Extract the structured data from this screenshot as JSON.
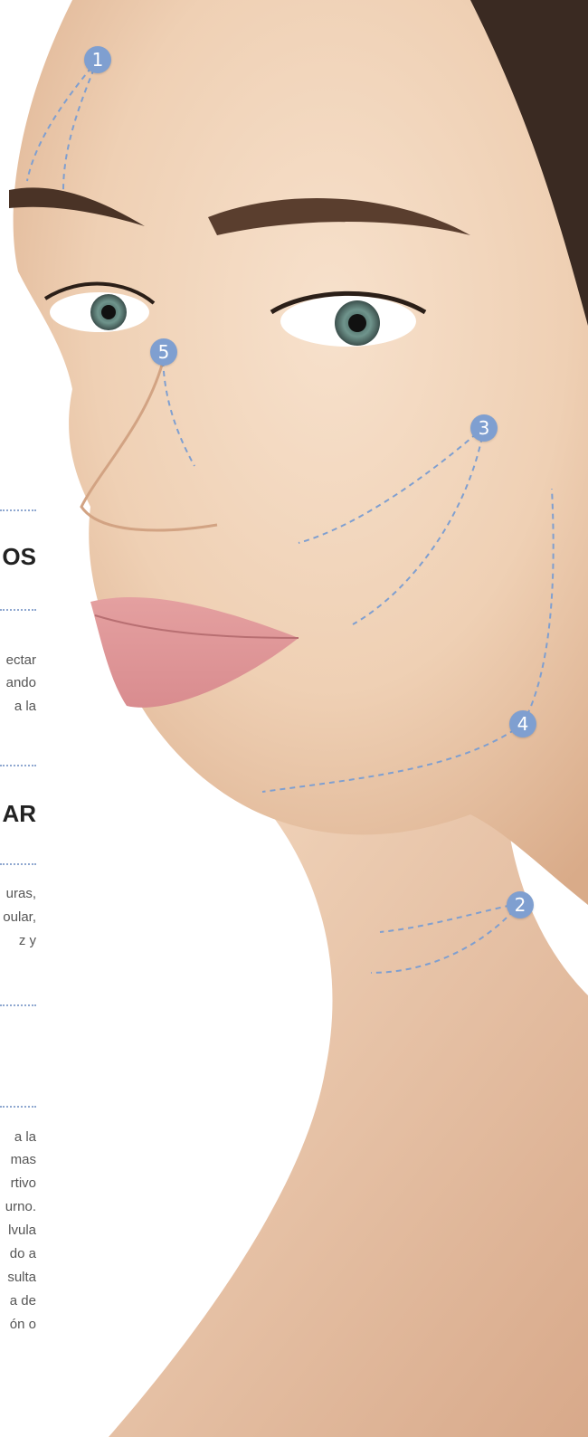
{
  "markers": [
    "1",
    "2",
    "3",
    "4",
    "5"
  ],
  "headings": [
    "OS",
    "AR"
  ],
  "fragments": {
    "block1": [
      "ectar",
      "ando",
      "a la"
    ],
    "block2": [
      "uras,",
      "oular,",
      "z y"
    ],
    "block3": [
      "a la",
      "mas",
      "rtivo",
      "urno.",
      "lvula",
      "do a",
      "sulta",
      "a de",
      "ón o"
    ]
  },
  "colors": {
    "marker": "#7f9fd0",
    "guide_line": "#7f9fd0",
    "dots": "#8fa8d0"
  }
}
